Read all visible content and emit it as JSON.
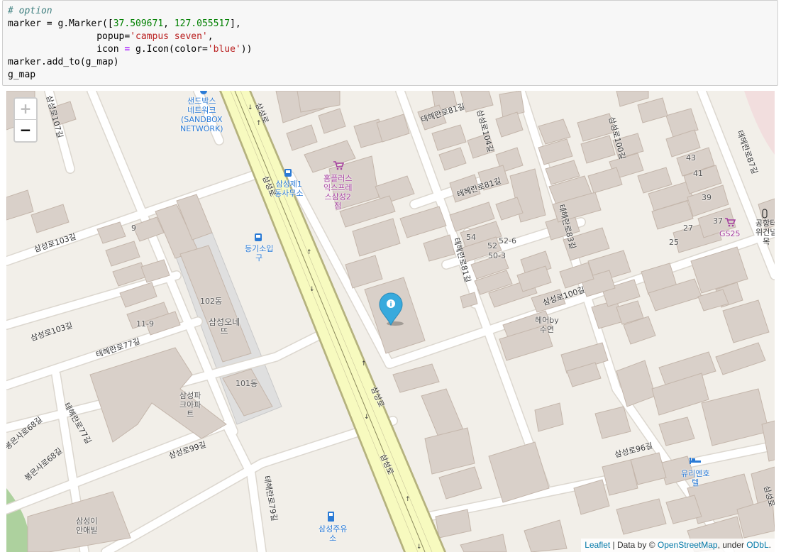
{
  "code": {
    "comment": "# option",
    "line1_var": "marker",
    "line1_eq": " = g.Marker([",
    "lat": "37.509671",
    "comma": ", ",
    "lng": "127.055517",
    "line1_end": "],",
    "line2_indent": "                popup=",
    "popup_str": "'campus seven'",
    "line2_end": ",",
    "line3_indent": "                icon ",
    "line3_eq": "=",
    "line3_mid": " g.Icon(color=",
    "icon_color_str": "'blue'",
    "line3_end": "))",
    "line4": "marker.add_to(g_map)",
    "line5": "g_map"
  },
  "map": {
    "zoom_in_label": "+",
    "zoom_out_label": "−",
    "marker": {
      "lat": 37.509671,
      "lng": 127.055517,
      "popup": "campus seven",
      "color": "#38aadd",
      "icon": "info-icon"
    },
    "attribution": {
      "leaflet": "Leaflet",
      "sep": " | Data by © ",
      "osm": "OpenStreetMap",
      "under": ", under ",
      "odbl": "ODbL",
      "dot": "."
    },
    "labels": {
      "sandbox": "샌드박스\n네트워크\n(SANDBOX\nNETWORK)",
      "samsung_station": "삼성제1\n동사무소",
      "homeplus": "홈플러스\n익스프레\n스삼성2\n점",
      "gym": "등기소입\n구",
      "b102": "102동",
      "samsung_onenet": "삼성오네\n뜨",
      "b101": "101동",
      "samsung_park": "삼성파\n크아파\n트",
      "hair": "헤어by\n수연",
      "gs25": "GS25",
      "yuri": "유리엔호\n텔",
      "samsung_oil": "삼성주유\n소",
      "samsung_anae": "삼성이\n안애빌",
      "airport": "공항터\n위건널\n목",
      "num9": "9",
      "num11_9": "11-9",
      "num54": "54",
      "num52": "52",
      "num52_6": "52-6",
      "num50_3": "50-3",
      "num43": "43",
      "num41": "41",
      "num39": "39",
      "num37": "37",
      "num27": "27",
      "num25": "25",
      "road_samsungro_1": "삼성로",
      "road_samsungro_2": "삼성로",
      "road_samsungro_3": "삼성로",
      "road_samsungro_4": "삼성로",
      "road_teheran81_a": "테헤란로81길",
      "road_teheran81_b": "테헤란로81길",
      "road_teheran81_c": "테헤란로81길",
      "road_samsung104": "삼성로104길",
      "road_samsung100_v": "삼성로100길",
      "road_teheran87": "테헤란로87길",
      "road_teheran83": "테헤란로83길",
      "road_samsung103_a": "삼성로103길",
      "road_samsung103_b": "삼성로103길",
      "road_samsung107": "삼성로107길",
      "road_teheran77": "테헤란로77길",
      "road_teheran77_b": "테헤란로77길",
      "road_samsung100": "삼성로100길",
      "road_samsung99": "삼성로99길",
      "road_teheran79": "테헤란로79길",
      "road_samsung96": "삼성로96길",
      "road_bongeun68_a": "봉은사로68길",
      "road_bongeun68_b": "봉은사로68길",
      "road_samsung_s": "삼성로",
      "road_samsungro_e": "삼성로"
    },
    "colors": {
      "land": "#f2efe9",
      "building": "#d9d0c9",
      "building_stroke": "#c4b6ab",
      "road": "#ffffff",
      "road_edge": "#dcd7cf",
      "primary_road": "#f7fabf",
      "primary_edge": "#b5b27e",
      "campus": "#e0dfdf",
      "green": "#add19e",
      "blue_poi": "#2b7bd6",
      "pink_poi": "#a63fa0"
    }
  }
}
